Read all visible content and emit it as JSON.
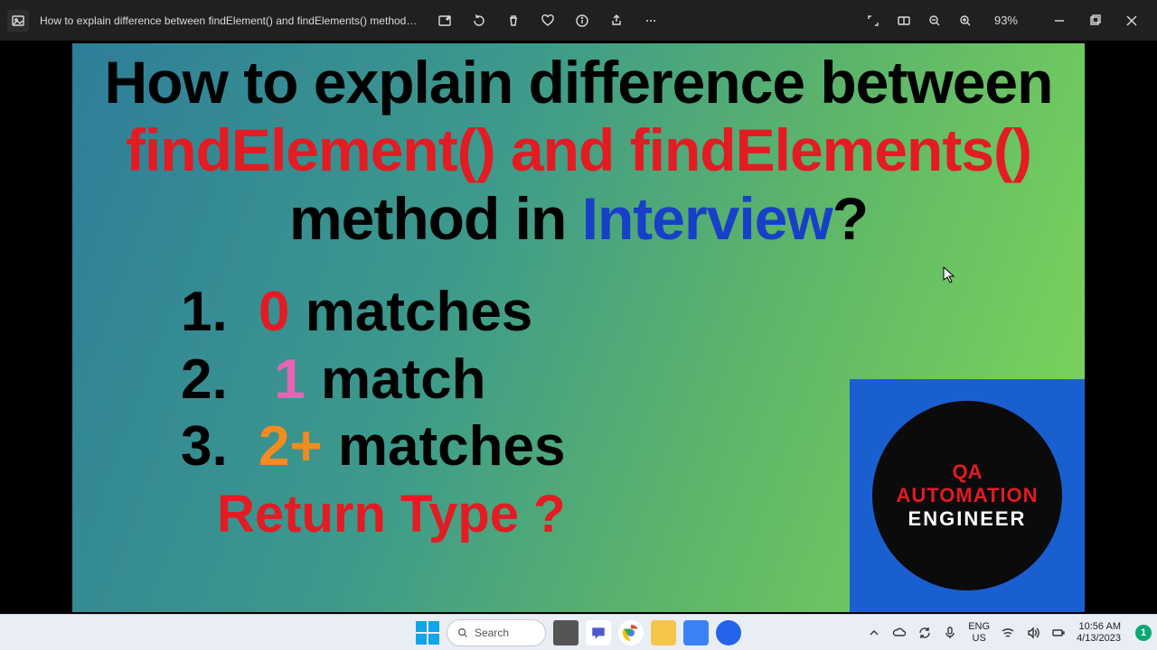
{
  "titlebar": {
    "title": "How to explain difference between findElement() and findElements() method in I...",
    "zoom": "93%"
  },
  "slide": {
    "heading": {
      "part1": "How to explain difference between",
      "part2": "findElement() and findElements()",
      "part3a": "method in ",
      "part3b": "Interview",
      "part3c": "?"
    },
    "items": [
      {
        "n": "1.",
        "accent": "0",
        "rest": " matches"
      },
      {
        "n": "2.",
        "accent": "1",
        "rest": " match"
      },
      {
        "n": "3.",
        "accent": "2+",
        "rest": " matches"
      }
    ],
    "return_type": "Return Type ?",
    "badge": {
      "l1": "QA",
      "l2": "AUTOMATION",
      "l3": "ENGINEER"
    }
  },
  "taskbar": {
    "search_placeholder": "Search",
    "lang1": "ENG",
    "lang2": "US",
    "time": "10:56 AM",
    "date": "4/13/2023",
    "notif_count": "1"
  }
}
